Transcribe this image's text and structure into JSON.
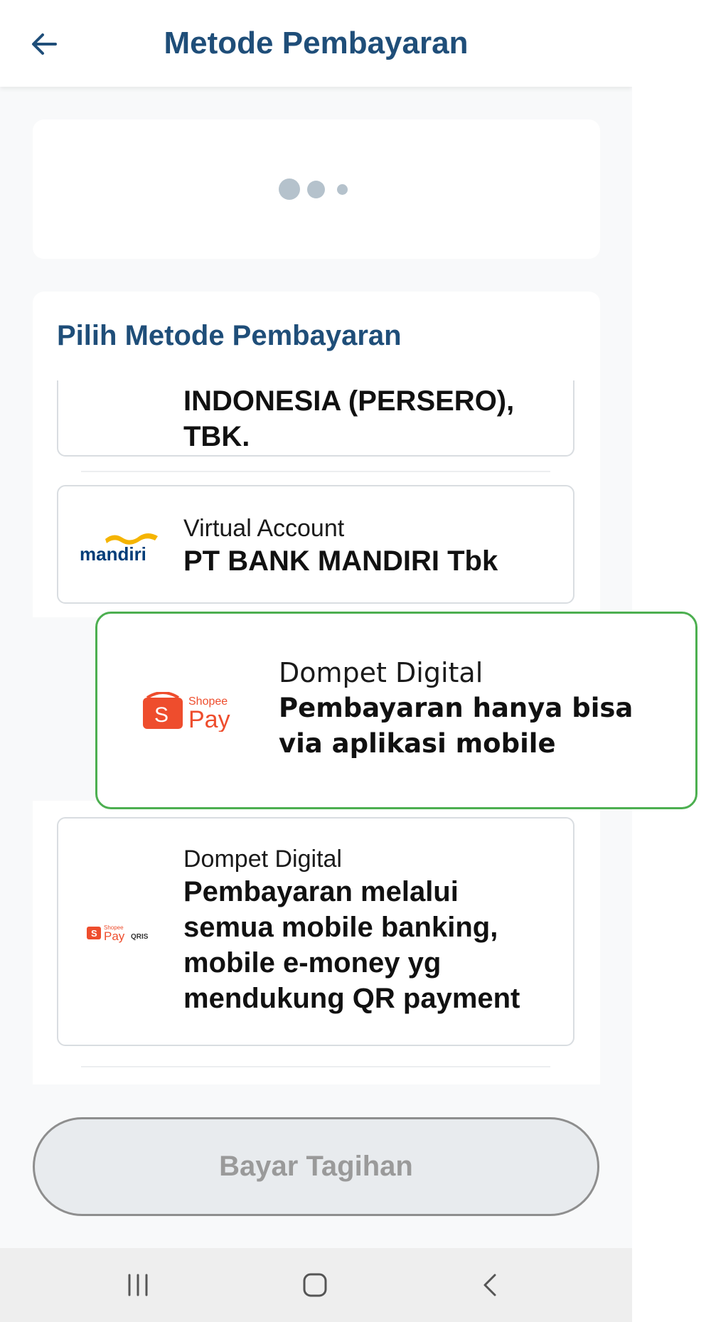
{
  "header": {
    "title": "Metode Pembayaran"
  },
  "section": {
    "title": "Pilih Metode Pembayaran"
  },
  "items": [
    {
      "category": "",
      "name_line1": "INDONESIA (PERSERO),",
      "name_line2": "TBK."
    },
    {
      "category": "Virtual Account",
      "name_line1": "PT BANK MANDIRI Tbk",
      "logo_text": "mandiri"
    },
    {
      "category": "Dompet Digital",
      "name_lines": [
        "Pembayaran melalui",
        "semua mobile banking,",
        "mobile e-money yg",
        "mendukung QR payment"
      ],
      "logo_text": "Shopee",
      "logo_pay": "Pay",
      "logo_qris": "QRIS"
    }
  ],
  "callout": {
    "category": "Dompet Digital",
    "name_lines": [
      "Pembayaran hanya bisa",
      "via aplikasi mobile"
    ],
    "logo_brand": "Shopee",
    "logo_pay": "Pay",
    "logo_s": "S"
  },
  "pay_button": {
    "label": "Bayar Tagihan"
  },
  "colors": {
    "primary": "#1f4e79",
    "highlight_border": "#4caf50",
    "shopee": "#ee4d2d",
    "mandiri_blue": "#003d79",
    "mandiri_gold": "#f5b400"
  },
  "icons": {
    "back": "arrow-left-icon",
    "nav_recent": "recent-apps-icon",
    "nav_home": "home-icon",
    "nav_back": "chevron-left-icon"
  }
}
